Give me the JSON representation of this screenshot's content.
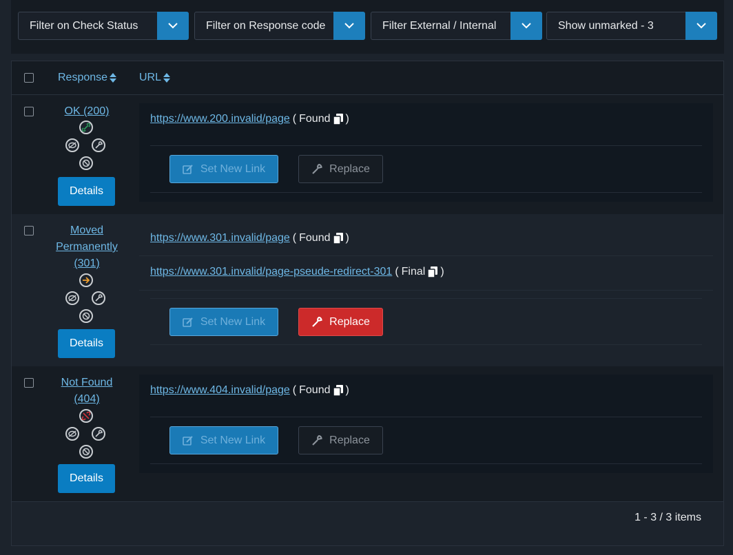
{
  "filters": [
    {
      "label": "Filter on Check Status"
    },
    {
      "label": "Filter on Response code"
    },
    {
      "label": "Filter External / Internal"
    },
    {
      "label": "Show unmarked - 3"
    }
  ],
  "table": {
    "headers": {
      "response": "Response",
      "url": "URL"
    },
    "rows": [
      {
        "status": "OK (200)",
        "status_color": "#2f9e5f",
        "urls": [
          {
            "url": "https://www.200.invalid/page",
            "tag": "Found"
          }
        ],
        "actions": {
          "set_link": "Set New Link",
          "replace": "Replace"
        },
        "details": "Details"
      },
      {
        "status": "Moved Permanently (301)",
        "status_color": "#f0a030",
        "urls": [
          {
            "url": "https://www.301.invalid/page",
            "tag": "Found"
          },
          {
            "url": "https://www.301.invalid/page-pseude-redirect-301",
            "tag": "Final"
          }
        ],
        "actions": {
          "set_link": "Set New Link",
          "replace": "Replace"
        },
        "details": "Details"
      },
      {
        "status": "Not Found (404)",
        "status_color": "#d8343a",
        "urls": [
          {
            "url": "https://www.404.invalid/page",
            "tag": "Found"
          }
        ],
        "actions": {
          "set_link": "Set New Link",
          "replace": "Replace"
        },
        "details": "Details"
      }
    ]
  },
  "pager": {
    "text": "1 - 3 / 3 items"
  },
  "colors": {
    "accent": "#1d7fbc",
    "danger": "#cc2a2a",
    "link": "#6eb8e6"
  }
}
